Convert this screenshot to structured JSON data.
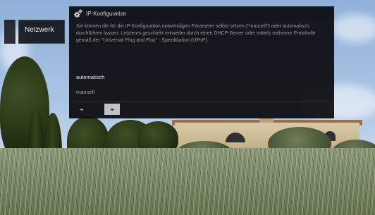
{
  "menu": {
    "active_tab_label": "Netzwerk"
  },
  "dialog": {
    "icon": "gear-icon",
    "title": "IP-Konfiguration",
    "description": "Sie können die für die IP-Konfiguration notwendigen Parameter selbst setzen (\"manuell\") oder automatisch durchführen lassen. Letzteres geschieht entweder durch einen DHCP-Server oder mittels mehrerer Protokolle gemäß der \"Universal Plug and Play\" - Spezifikation (UPnP).",
    "options": [
      {
        "label": "automatisch",
        "selected": true
      },
      {
        "label": "manuell",
        "selected": false
      }
    ],
    "nav": {
      "prev_label": "◂◂",
      "next_label": "▸▸"
    }
  }
}
